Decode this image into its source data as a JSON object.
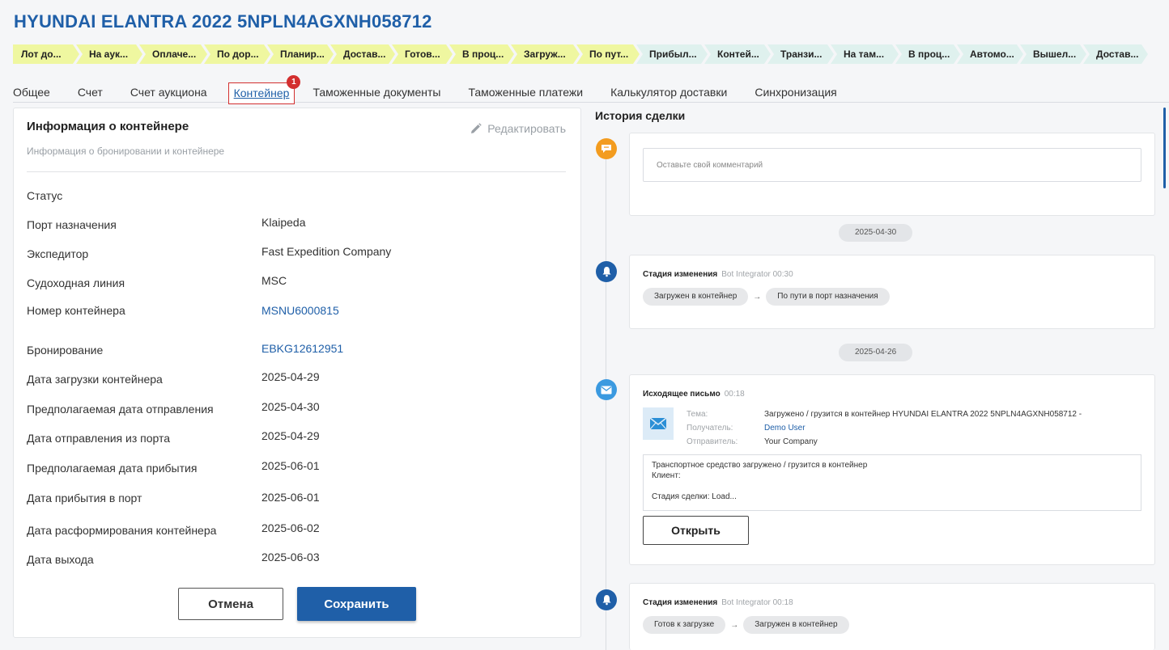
{
  "title": "HYUNDAI ELANTRA 2022 5NPLN4AGXNH058712",
  "stages": {
    "done": [
      "Лот до...",
      "На аук...",
      "Оплаче...",
      "По дор...",
      "Планир...",
      "Достав...",
      "Готов...",
      "В проц...",
      "Загруж...",
      "По пут..."
    ],
    "todo": [
      "Прибыл...",
      "Контей...",
      "Транзи...",
      "На там...",
      "В проц...",
      "Автомо...",
      "Вышел...",
      "Достав..."
    ]
  },
  "tabs": [
    "Общее",
    "Счет",
    "Счет аукциона",
    "Контейнер",
    "Таможенные документы",
    "Таможенные платежи",
    "Калькулятор доставки",
    "Синхронизация"
  ],
  "active_tab_badge": "1",
  "card": {
    "title": "Информация о контейнере",
    "subtitle": "Информация о бронировании и контейнере",
    "edit_label": "Редактировать",
    "fields": [
      {
        "label": "Статус",
        "value": ""
      },
      {
        "label": "Порт назначения",
        "value": "Klaipeda"
      },
      {
        "label": "Экспедитор",
        "value": "Fast Expedition Company"
      },
      {
        "label": "Судоходная линия",
        "value": "MSC"
      },
      {
        "label": "Номер контейнера",
        "value": "MSNU6000815"
      },
      {
        "label": "Бронирование",
        "value": "EBKG12612951"
      },
      {
        "label": "Дата загрузки контейнера",
        "value": "2025-04-29"
      },
      {
        "label": "Предполагаемая дата отправления",
        "value": "2025-04-30"
      },
      {
        "label": "Дата отправления из порта",
        "value": "2025-04-29"
      },
      {
        "label": "Предполагаемая дата прибытия",
        "value": "2025-06-01"
      },
      {
        "label": "Дата прибытия в порт",
        "value": "2025-06-01"
      },
      {
        "label": "Дата расформирования контейнера",
        "value": "2025-06-02"
      },
      {
        "label": "Дата выхода",
        "value": "2025-06-03"
      }
    ],
    "cancel_label": "Отмена",
    "save_label": "Сохранить"
  },
  "history": {
    "title": "История сделки",
    "comment_placeholder": "Оставьте свой комментарий",
    "date1": "2025-04-30",
    "date2": "2025-04-26",
    "event1": {
      "title": "Стадия изменения",
      "meta": "Bot Integrator 00:30",
      "from": "Загружен в контейнер",
      "to": "По пути в порт назначения"
    },
    "mail": {
      "title": "Исходящее письмо",
      "meta": "00:18",
      "subject_label": "Тема:",
      "subject": "Загружено / грузится в контейнер HYUNDAI ELANTRA 2022 5NPLN4AGXNH058712 -",
      "recipient_label": "Получатель:",
      "recipient": "Demo User",
      "sender_label": "Отправитель:",
      "sender": "Your Company",
      "body": [
        "Транспортное средство загружено / грузится в контейнер",
        "Клиент:",
        "",
        "Стадия сделки: Load..."
      ],
      "open_label": "Открыть"
    },
    "event2": {
      "title": "Стадия изменения",
      "meta": "Bot Integrator 00:18",
      "from": "Готов к загрузке",
      "to": "Загружен в контейнер"
    }
  },
  "colors": {
    "accent": "#1f5fa8",
    "stage_done": "#eff7a0",
    "stage_todo": "#dff1ee",
    "badge": "#d32f2f",
    "comment_icon": "#f39c1f"
  }
}
